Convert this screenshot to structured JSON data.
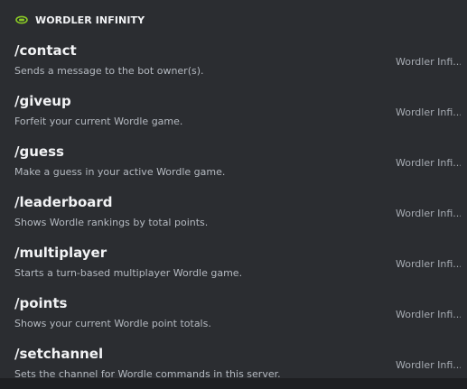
{
  "header": {
    "icon": "wordler-app-icon",
    "title": "WORDLER INFINITY"
  },
  "commands": [
    {
      "name": "/contact",
      "description": "Sends a message to the bot owner(s).",
      "source": "Wordler Infi..."
    },
    {
      "name": "/giveup",
      "description": "Forfeit your current Wordle game.",
      "source": "Wordler Infi..."
    },
    {
      "name": "/guess",
      "description": "Make a guess in your active Wordle game.",
      "source": "Wordler Infi..."
    },
    {
      "name": "/leaderboard",
      "description": "Shows Wordle rankings by total points.",
      "source": "Wordler Infi..."
    },
    {
      "name": "/multiplayer",
      "description": "Starts a turn-based multiplayer Wordle game.",
      "source": "Wordler Infi..."
    },
    {
      "name": "/points",
      "description": "Shows your current Wordle point totals.",
      "source": "Wordler Infi..."
    },
    {
      "name": "/setchannel",
      "description": "Sets the channel for Wordle commands in this server.",
      "source": "Wordler Infi..."
    }
  ],
  "colors": {
    "background": "#2b2d31",
    "icon_accent": "#8ac926"
  }
}
